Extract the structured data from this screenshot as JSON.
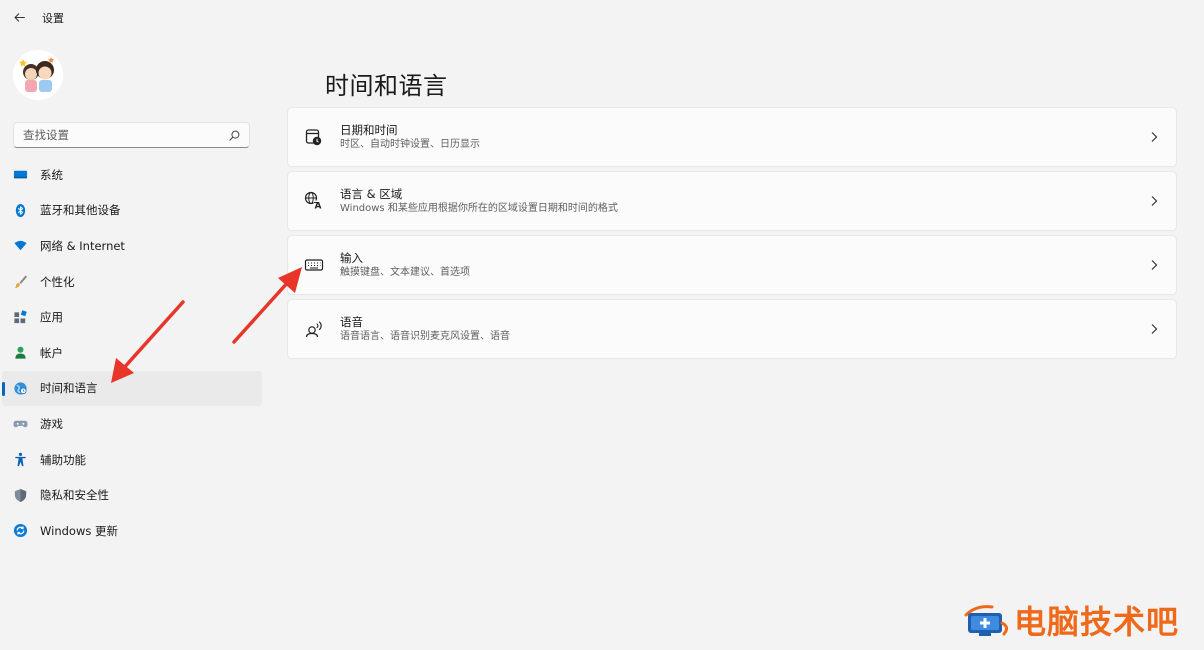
{
  "window": {
    "title": "设置"
  },
  "search": {
    "placeholder": "查找设置"
  },
  "sidebar": {
    "items": [
      {
        "label": "系统",
        "icon": "monitor-icon"
      },
      {
        "label": "蓝牙和其他设备",
        "icon": "bluetooth-icon"
      },
      {
        "label": "网络 & Internet",
        "icon": "wifi-icon"
      },
      {
        "label": "个性化",
        "icon": "brush-icon"
      },
      {
        "label": "应用",
        "icon": "apps-icon"
      },
      {
        "label": "帐户",
        "icon": "person-icon"
      },
      {
        "label": "时间和语言",
        "icon": "globe-clock-icon",
        "active": true
      },
      {
        "label": "游戏",
        "icon": "gamepad-icon"
      },
      {
        "label": "辅助功能",
        "icon": "accessibility-icon"
      },
      {
        "label": "隐私和安全性",
        "icon": "shield-icon"
      },
      {
        "label": "Windows 更新",
        "icon": "update-icon"
      }
    ]
  },
  "main": {
    "title": "时间和语言",
    "cards": [
      {
        "title": "日期和时间",
        "subtitle": "时区、自动时钟设置、日历显示",
        "icon": "calendar-clock-icon"
      },
      {
        "title": "语言 & 区域",
        "subtitle": "Windows 和某些应用根据你所在的区域设置日期和时间的格式",
        "icon": "language-icon"
      },
      {
        "title": "输入",
        "subtitle": "触摸键盘、文本建议、首选项",
        "icon": "keyboard-icon"
      },
      {
        "title": "语音",
        "subtitle": "语音语言、语音识别麦克风设置、语音",
        "icon": "speech-icon"
      }
    ]
  },
  "watermark": {
    "text": "电脑技术吧"
  },
  "colors": {
    "accent": "#0067c0",
    "annotation_arrow": "#e8352a",
    "watermark": "#ee6a1a"
  }
}
